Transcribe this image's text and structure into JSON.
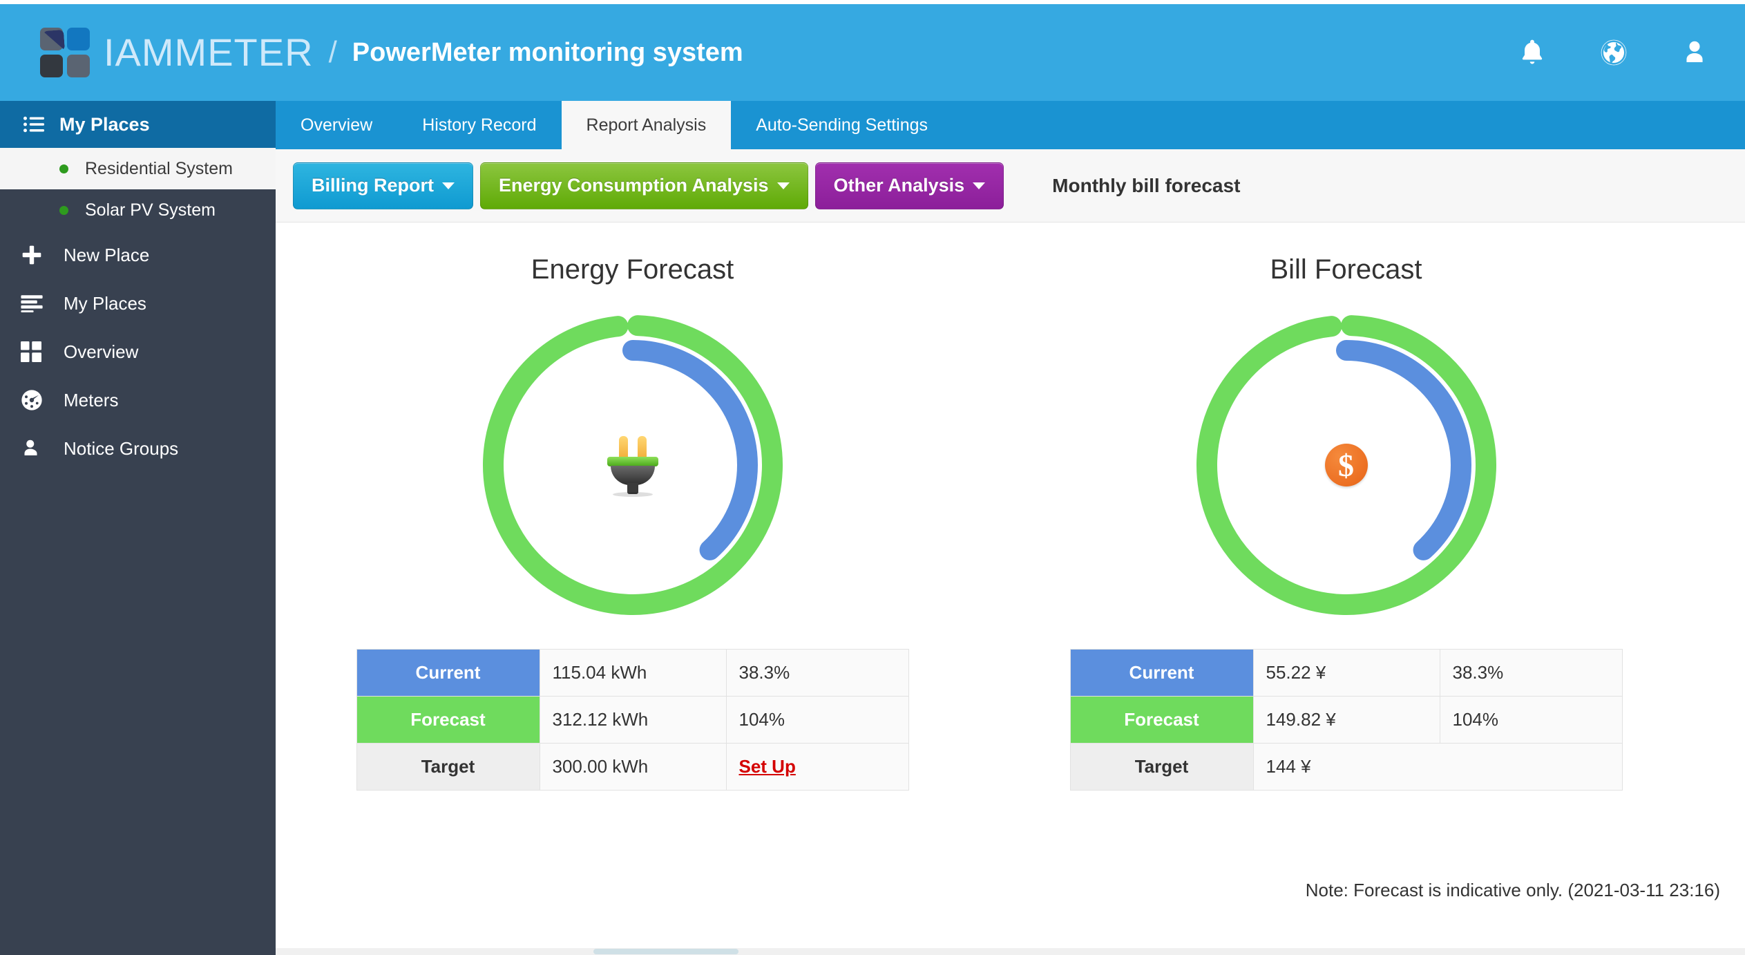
{
  "header": {
    "brand_name": "IAMMETER",
    "separator": "/",
    "subtitle": "PowerMeter monitoring system",
    "icons": [
      "bell-icon",
      "globe-icon",
      "user-icon"
    ]
  },
  "sidebar": {
    "header_label": "My Places",
    "places": [
      {
        "label": "Residential System",
        "active": true
      },
      {
        "label": "Solar PV System",
        "active": false
      }
    ],
    "items": [
      {
        "label": "New Place",
        "icon": "plus-icon"
      },
      {
        "label": "My Places",
        "icon": "list-icon"
      },
      {
        "label": "Overview",
        "icon": "grid-icon"
      },
      {
        "label": "Meters",
        "icon": "gauge-icon"
      },
      {
        "label": "Notice Groups",
        "icon": "user-icon"
      }
    ]
  },
  "tabs": [
    {
      "label": "Overview",
      "active": false
    },
    {
      "label": "History Record",
      "active": false
    },
    {
      "label": "Report Analysis",
      "active": true
    },
    {
      "label": "Auto-Sending Settings",
      "active": false
    }
  ],
  "toolbar": {
    "billing_report": "Billing Report",
    "energy_consumption": "Energy Consumption Analysis",
    "other_analysis": "Other Analysis",
    "section_title": "Monthly bill forecast"
  },
  "colors": {
    "header_blue": "#36a9e1",
    "sidebar_dark": "#384150",
    "tab_blue": "#1a93d2",
    "gauge_green": "#6fdb5d",
    "gauge_blue": "#5b8fde",
    "btn_blue": "#0f9ad1",
    "btn_green": "#6fb215",
    "btn_purple": "#9a26a8",
    "link_red": "#d40000",
    "coin_orange": "#ec6f22"
  },
  "chart_data": [
    {
      "type": "pie",
      "title": "Energy Forecast",
      "center_icon": "plug-icon",
      "unit": "kWh",
      "rings": [
        {
          "name": "Forecast",
          "percent": 104,
          "color": "#6fdb5d",
          "radius": "outer"
        },
        {
          "name": "Current",
          "percent": 38.3,
          "color": "#5b8fde",
          "radius": "inner"
        }
      ],
      "legend": [
        "Current",
        "Forecast",
        "Target"
      ],
      "rows": [
        {
          "label": "Current",
          "value": "115.04 kWh",
          "percent": "38.3%",
          "label_color": "#5b8fde"
        },
        {
          "label": "Forecast",
          "value": "312.12 kWh",
          "percent": "104%",
          "label_color": "#6fdb5d"
        },
        {
          "label": "Target",
          "value": "300.00 kWh",
          "percent": "Set Up",
          "label_color": "#eeeeee"
        }
      ]
    },
    {
      "type": "pie",
      "title": "Bill Forecast",
      "center_icon": "dollar-coin-icon",
      "unit": "¥",
      "rings": [
        {
          "name": "Forecast",
          "percent": 104,
          "color": "#6fdb5d",
          "radius": "outer"
        },
        {
          "name": "Current",
          "percent": 38.3,
          "color": "#5b8fde",
          "radius": "inner"
        }
      ],
      "legend": [
        "Current",
        "Forecast",
        "Target"
      ],
      "rows": [
        {
          "label": "Current",
          "value": "55.22 ¥",
          "percent": "38.3%",
          "label_color": "#5b8fde"
        },
        {
          "label": "Forecast",
          "value": "149.82 ¥",
          "percent": "104%",
          "label_color": "#6fdb5d"
        },
        {
          "label": "Target",
          "value": "144 ¥",
          "percent": "",
          "label_color": "#eeeeee"
        }
      ]
    }
  ],
  "panels": {
    "energy": {
      "title": "Energy Forecast",
      "rows": {
        "current_label": "Current",
        "current_value": "115.04 kWh",
        "current_pct": "38.3%",
        "forecast_label": "Forecast",
        "forecast_value": "312.12 kWh",
        "forecast_pct": "104%",
        "target_label": "Target",
        "target_value": "300.00 kWh",
        "target_action": "Set Up"
      }
    },
    "bill": {
      "title": "Bill Forecast",
      "rows": {
        "current_label": "Current",
        "current_value": "55.22 ¥",
        "current_pct": "38.3%",
        "forecast_label": "Forecast",
        "forecast_value": "149.82 ¥",
        "forecast_pct": "104%",
        "target_label": "Target",
        "target_value": "144 ¥"
      }
    }
  },
  "footer": {
    "note": "Note: Forecast is indicative only. (2021-03-11 23:16)"
  }
}
